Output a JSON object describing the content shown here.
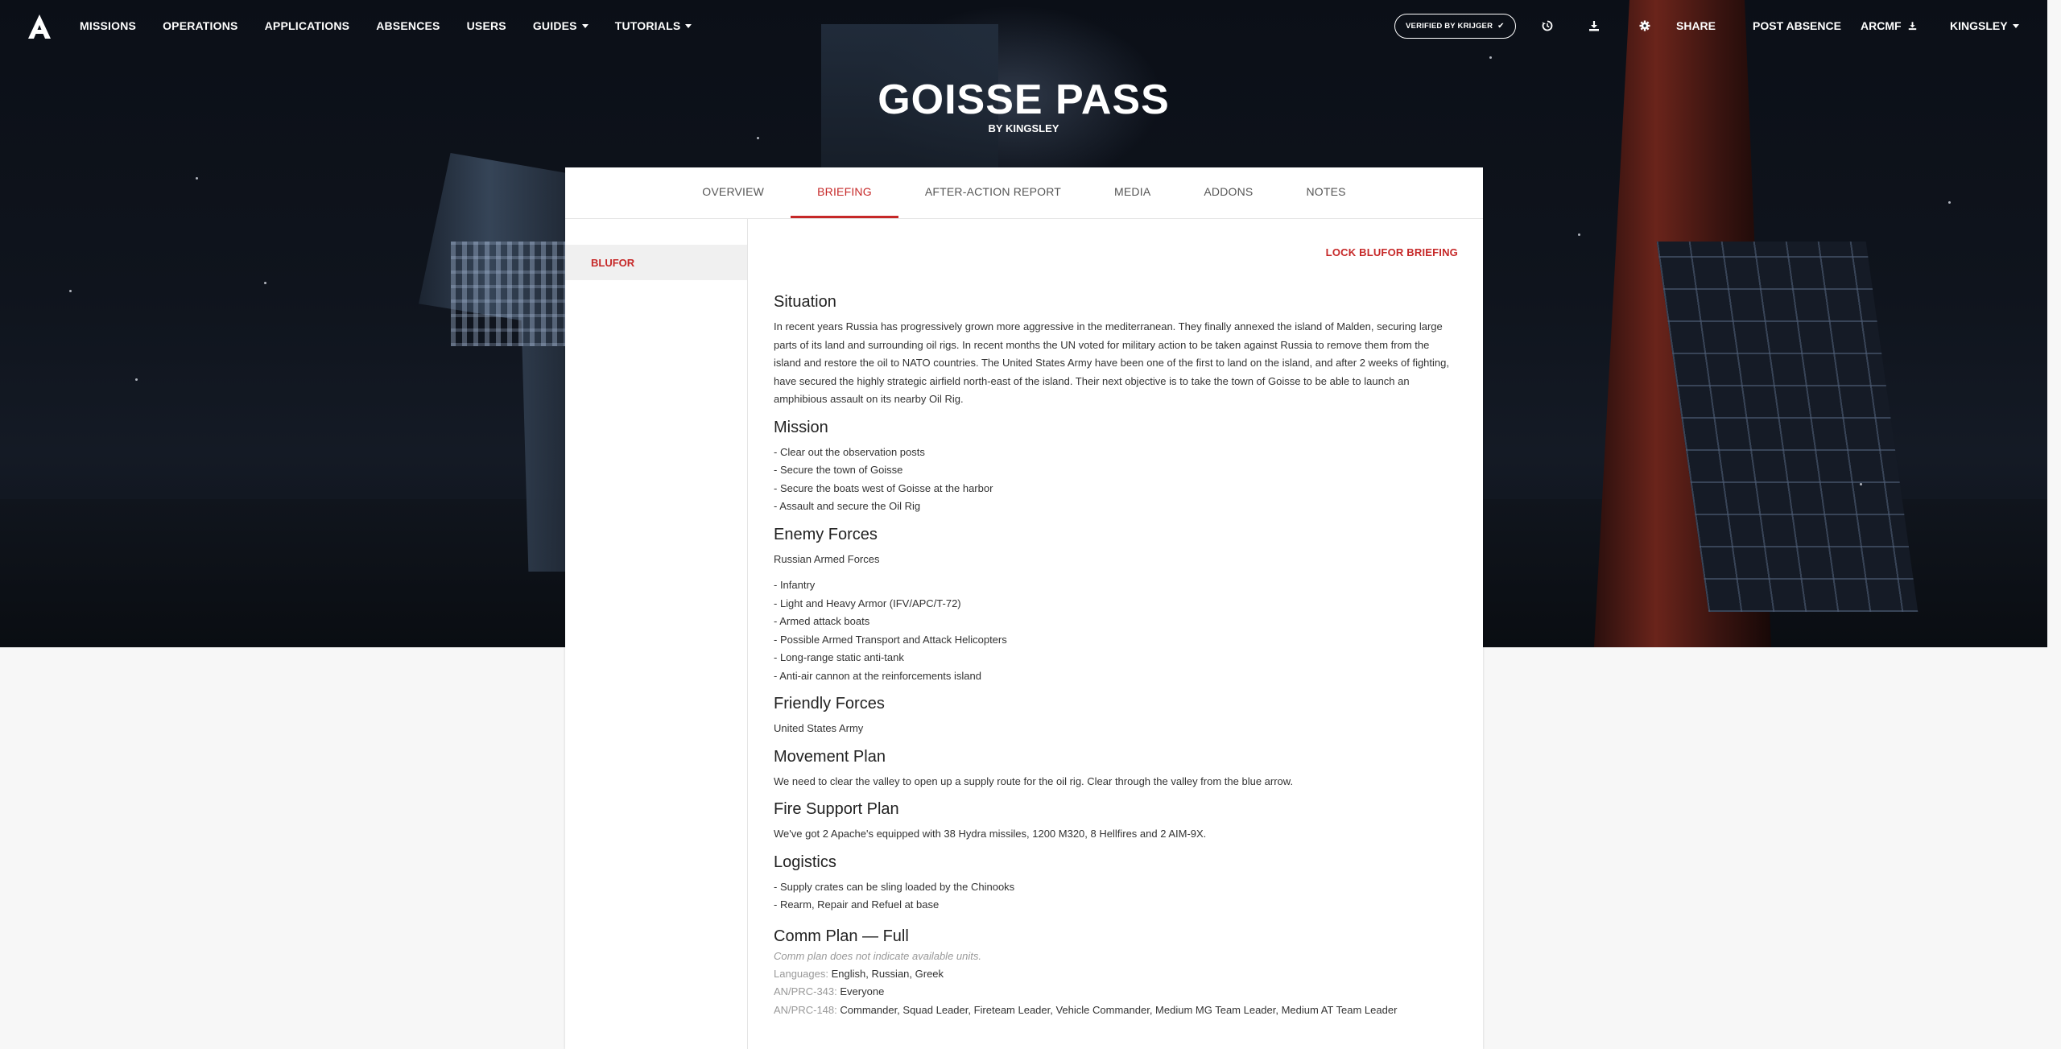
{
  "navbar": {
    "items": [
      "MISSIONS",
      "OPERATIONS",
      "APPLICATIONS",
      "ABSENCES",
      "USERS",
      "GUIDES",
      "TUTORIALS"
    ],
    "verified_label": "VERIFIED BY KRIJGER",
    "share_label": "SHARE",
    "post_absence_label": "POST ABSENCE",
    "arcmf_label": "ARCMF",
    "user_label": "KINGSLEY"
  },
  "hero": {
    "title": "GOISSE PASS",
    "byline": "BY KINGSLEY"
  },
  "tabs": [
    "OVERVIEW",
    "BRIEFING",
    "AFTER-ACTION REPORT",
    "MEDIA",
    "ADDONS",
    "NOTES"
  ],
  "active_tab": "BRIEFING",
  "sidebar": {
    "items": [
      "BLUFOR"
    ]
  },
  "briefing": {
    "lock_label": "LOCK BLUFOR BRIEFING",
    "situation": {
      "heading": "Situation",
      "text": "In recent years Russia has progressively grown more aggressive in the mediterranean. They finally annexed the island of Malden, securing large parts of its land and surrounding oil rigs. In recent months the UN voted for military action to be taken against Russia to remove them from the island and restore the oil to NATO countries. The United States Army have been one of the first to land on the island, and after 2 weeks of fighting, have secured the highly strategic airfield north-east of the island. Their next objective is to take the town of Goisse to be able to launch an amphibious assault on its nearby Oil Rig."
    },
    "mission": {
      "heading": "Mission",
      "lines": [
        "- Clear out the observation posts",
        "- Secure the town of Goisse",
        "- Secure the boats west of Goisse at the harbor",
        "- Assault and secure the Oil Rig"
      ]
    },
    "enemy": {
      "heading": "Enemy Forces",
      "intro": "Russian Armed Forces",
      "lines": [
        "- Infantry",
        "- Light and Heavy Armor (IFV/APC/T-72)",
        "- Armed attack boats",
        "- Possible Armed Transport and Attack Helicopters",
        "- Long-range static anti-tank",
        "- Anti-air cannon at the reinforcements island"
      ]
    },
    "friendly": {
      "heading": "Friendly Forces",
      "text": "United States Army"
    },
    "movement": {
      "heading": "Movement Plan",
      "text": "We need to clear the valley to open up a supply route for the oil rig. Clear through the valley from the blue arrow."
    },
    "fire": {
      "heading": "Fire Support Plan",
      "text": "We've got 2 Apache's equipped with 38 Hydra missiles, 1200 M320, 8 Hellfires and 2 AIM-9X."
    },
    "logistics": {
      "heading": "Logistics",
      "lines": [
        "- Supply crates can be sling loaded by the Chinooks",
        "- Rearm, Repair and Refuel at base"
      ]
    },
    "comm": {
      "heading": "Comm Plan — Full",
      "note": "Comm plan does not indicate available units.",
      "languages_key": "Languages:",
      "languages_val": "English, Russian, Greek",
      "radio1_key": "AN/PRC-343:",
      "radio1_val": "Everyone",
      "radio2_key": "AN/PRC-148:",
      "radio2_val": "Commander, Squad Leader, Fireteam Leader, Vehicle Commander, Medium MG Team Leader, Medium AT Team Leader"
    }
  },
  "colors": {
    "accent": "#c62828",
    "card": "#ffffff",
    "nav_text": "#ffffff"
  }
}
